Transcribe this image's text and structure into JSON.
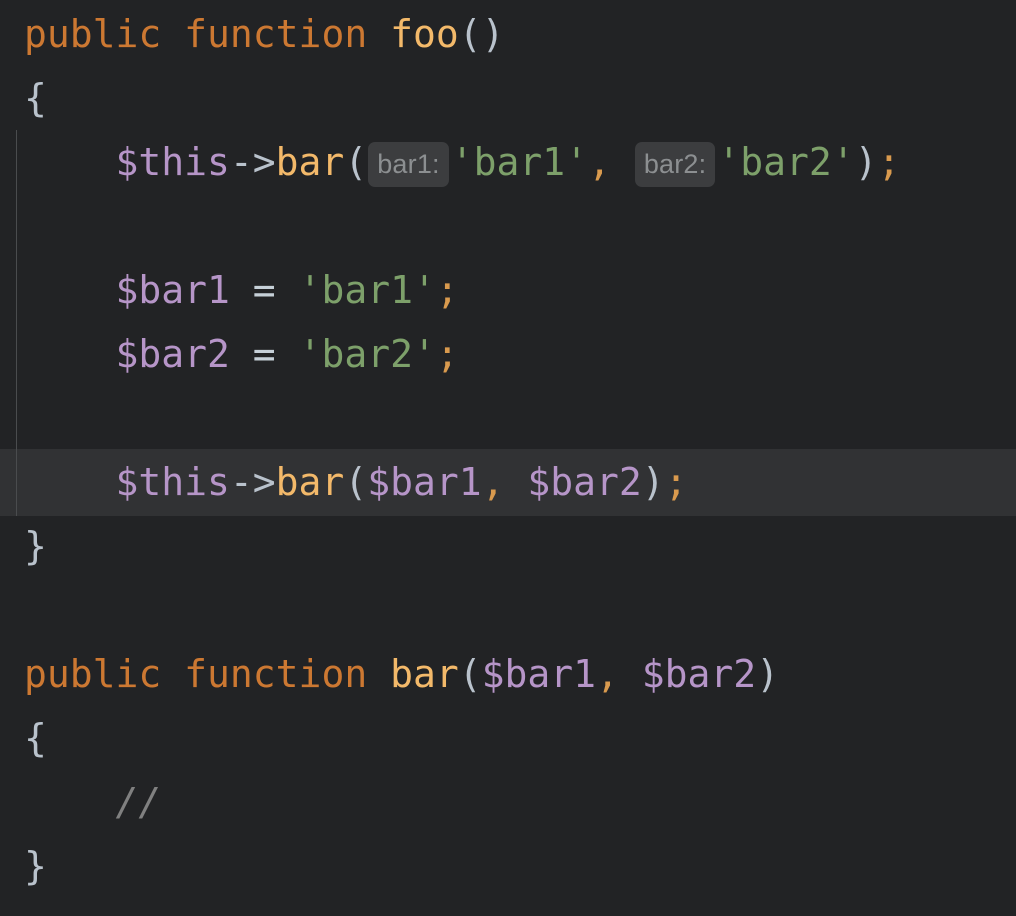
{
  "editor": {
    "language": "php",
    "theme": "dark",
    "background_color": "#222325",
    "current_line_highlight_color": "#313234",
    "indent_guide_color": "#4a4c4e",
    "colors": {
      "keyword": "#CC7832",
      "function": "#F3B96A",
      "variable": "#B695C8",
      "punctuation": "#B9C2CC",
      "string": "#7DA06A",
      "operator": "#D99A4E",
      "comment": "#808080",
      "hint_background": "#3C3D3F",
      "hint_text": "#8C8F91"
    }
  },
  "code": {
    "line1": {
      "keyword_public": "public",
      "keyword_function": "function",
      "name": "foo",
      "parens": "()"
    },
    "line2": {
      "brace": "{"
    },
    "line3": {
      "indent": "    ",
      "object": "$this",
      "arrow": "->",
      "method": "bar",
      "open_paren": "(",
      "hint1": "bar1:",
      "arg1": "'bar1'",
      "comma": ",",
      "hint2": "bar2:",
      "arg2": "'bar2'",
      "close_paren": ")",
      "semicolon": ";"
    },
    "line5": {
      "indent": "    ",
      "variable": "$bar1",
      "equals": "=",
      "value": "'bar1'",
      "semicolon": ";"
    },
    "line6": {
      "indent": "    ",
      "variable": "$bar2",
      "equals": "=",
      "value": "'bar2'",
      "semicolon": ";"
    },
    "line8": {
      "indent": "    ",
      "object": "$this",
      "arrow": "->",
      "method": "bar",
      "open_paren": "(",
      "arg1": "$bar1",
      "comma": ",",
      "space": " ",
      "arg2": "$bar2",
      "close_paren": ")",
      "semicolon": ";"
    },
    "line9": {
      "brace": "}"
    },
    "line11": {
      "keyword_public": "public",
      "keyword_function": "function",
      "name": "bar",
      "open_paren": "(",
      "param1": "$bar1",
      "comma": ",",
      "space": " ",
      "param2": "$bar2",
      "close_paren": ")"
    },
    "line12": {
      "brace": "{"
    },
    "line13": {
      "indent": "    ",
      "comment": "//"
    },
    "line14": {
      "brace": "}"
    }
  }
}
